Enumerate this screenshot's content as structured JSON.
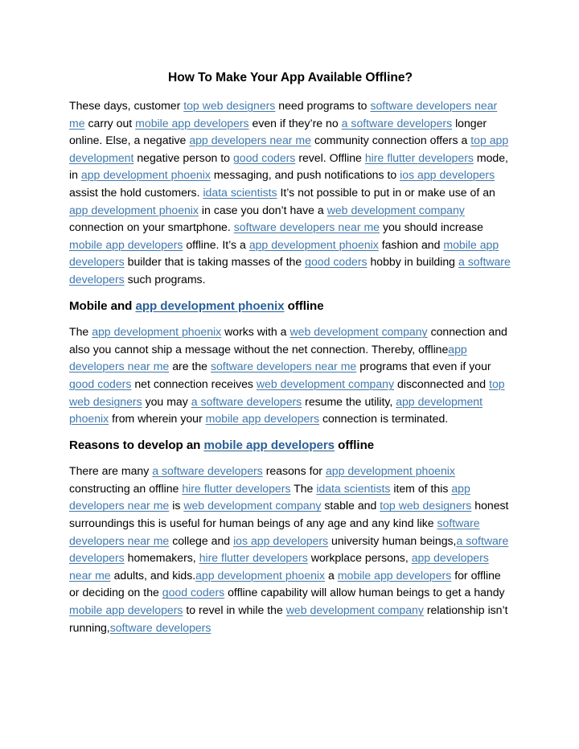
{
  "document": {
    "title": "How To Make Your App Available Offline?",
    "link_color": "#4179ad",
    "heading_link_color": "#2a6099",
    "text_color": "#000000",
    "background_color": "#ffffff"
  },
  "blocks": [
    {
      "type": "paragraph",
      "name": "paragraph-intro",
      "runs": [
        {
          "t": "text",
          "v": "These days, customer "
        },
        {
          "t": "link",
          "v": "top web designers"
        },
        {
          "t": "text",
          "v": " need programs to "
        },
        {
          "t": "link",
          "v": "software developers near me"
        },
        {
          "t": "text",
          "v": " carry out "
        },
        {
          "t": "link",
          "v": "mobile app developers"
        },
        {
          "t": "text",
          "v": " even if they’re no "
        },
        {
          "t": "link",
          "v": "a software developers"
        },
        {
          "t": "text",
          "v": " longer online. Else, a negative "
        },
        {
          "t": "link",
          "v": "app developers near me"
        },
        {
          "t": "text",
          "v": " community connection offers a "
        },
        {
          "t": "link",
          "v": "top app development"
        },
        {
          "t": "text",
          "v": " negative person to "
        },
        {
          "t": "link",
          "v": "good coders"
        },
        {
          "t": "text",
          "v": " revel. Offline "
        },
        {
          "t": "link",
          "v": "hire flutter developers"
        },
        {
          "t": "text",
          "v": " mode, in "
        },
        {
          "t": "link",
          "v": "app development phoenix"
        },
        {
          "t": "text",
          "v": " messaging, and push notifications to "
        },
        {
          "t": "link",
          "v": "ios app developers"
        },
        {
          "t": "text",
          "v": " assist the hold customers. "
        },
        {
          "t": "link",
          "v": "idata scientists"
        },
        {
          "t": "text",
          "v": " It’s not possible to put in or make use of an "
        },
        {
          "t": "link",
          "v": "app development phoenix"
        },
        {
          "t": "text",
          "v": " in case you don’t have a "
        },
        {
          "t": "link",
          "v": "web development company"
        },
        {
          "t": "text",
          "v": " connection on your smartphone. "
        },
        {
          "t": "link",
          "v": "software developers near me"
        },
        {
          "t": "text",
          "v": " you should increase "
        },
        {
          "t": "link",
          "v": "mobile app developers"
        },
        {
          "t": "text",
          "v": " offline. It’s a "
        },
        {
          "t": "link",
          "v": "app development phoenix"
        },
        {
          "t": "text",
          "v": " fashion and "
        },
        {
          "t": "link",
          "v": "mobile app developers"
        },
        {
          "t": "text",
          "v": " builder that is taking masses of the "
        },
        {
          "t": "link",
          "v": "good coders"
        },
        {
          "t": "text",
          "v": " hobby in building "
        },
        {
          "t": "link",
          "v": "a software developers"
        },
        {
          "t": "text",
          "v": " such programs."
        }
      ]
    },
    {
      "type": "heading",
      "name": "heading-mobile-and-offline",
      "runs": [
        {
          "t": "text",
          "v": "Mobile and "
        },
        {
          "t": "link",
          "v": "app development phoenix"
        },
        {
          "t": "text",
          "v": " offline"
        }
      ]
    },
    {
      "type": "paragraph",
      "name": "paragraph-mobile-offline",
      "runs": [
        {
          "t": "text",
          "v": "The "
        },
        {
          "t": "link",
          "v": "app development phoenix"
        },
        {
          "t": "text",
          "v": " works with a "
        },
        {
          "t": "link",
          "v": "web development company"
        },
        {
          "t": "text",
          "v": " connection and also you cannot ship a message without the net connection. Thereby, offline"
        },
        {
          "t": "link",
          "v": "app developers near me"
        },
        {
          "t": "text",
          "v": " are the "
        },
        {
          "t": "link",
          "v": "software developers near me"
        },
        {
          "t": "text",
          "v": " programs that even if your "
        },
        {
          "t": "link",
          "v": "good coders"
        },
        {
          "t": "text",
          "v": " net connection receives "
        },
        {
          "t": "link",
          "v": "web development company"
        },
        {
          "t": "text",
          "v": " disconnected and "
        },
        {
          "t": "link",
          "v": "top web designers"
        },
        {
          "t": "text",
          "v": " you may "
        },
        {
          "t": "link",
          "v": "a software developers"
        },
        {
          "t": "text",
          "v": " resume the utility, "
        },
        {
          "t": "link",
          "v": "app development phoenix"
        },
        {
          "t": "text",
          "v": " from wherein your "
        },
        {
          "t": "link",
          "v": "mobile app developers"
        },
        {
          "t": "text",
          "v": " connection is terminated."
        }
      ]
    },
    {
      "type": "heading",
      "name": "heading-reasons-to-develop",
      "runs": [
        {
          "t": "text",
          "v": "Reasons to develop an "
        },
        {
          "t": "link",
          "v": "mobile app developers"
        },
        {
          "t": "text",
          "v": " offline"
        }
      ]
    },
    {
      "type": "paragraph",
      "name": "paragraph-reasons",
      "runs": [
        {
          "t": "text",
          "v": "There are many "
        },
        {
          "t": "link",
          "v": "a software developers"
        },
        {
          "t": "text",
          "v": " reasons for "
        },
        {
          "t": "link",
          "v": "app development phoenix"
        },
        {
          "t": "text",
          "v": " constructing an offline "
        },
        {
          "t": "link",
          "v": "hire flutter developers"
        },
        {
          "t": "text",
          "v": " The "
        },
        {
          "t": "link",
          "v": "idata scientists"
        },
        {
          "t": "text",
          "v": " item of this "
        },
        {
          "t": "link",
          "v": "app developers near me"
        },
        {
          "t": "text",
          "v": " is "
        },
        {
          "t": "link",
          "v": "web development company"
        },
        {
          "t": "text",
          "v": " stable and "
        },
        {
          "t": "link",
          "v": "top web designers"
        },
        {
          "t": "text",
          "v": " honest surroundings this is useful for human beings of any age and any kind like "
        },
        {
          "t": "link",
          "v": "software developers near me"
        },
        {
          "t": "text",
          "v": " college and "
        },
        {
          "t": "link",
          "v": "ios app developers"
        },
        {
          "t": "text",
          "v": " university human beings,"
        },
        {
          "t": "link",
          "v": "a software developers"
        },
        {
          "t": "text",
          "v": " homemakers, "
        },
        {
          "t": "link",
          "v": "hire flutter developers"
        },
        {
          "t": "text",
          "v": " workplace persons, "
        },
        {
          "t": "link",
          "v": "app developers near me"
        },
        {
          "t": "text",
          "v": " adults, and kids."
        },
        {
          "t": "link",
          "v": "app development phoenix"
        },
        {
          "t": "text",
          "v": " a "
        },
        {
          "t": "link",
          "v": "mobile app developers"
        },
        {
          "t": "text",
          "v": " for offline or deciding on the "
        },
        {
          "t": "link",
          "v": "good coders"
        },
        {
          "t": "text",
          "v": " offline capability will allow human beings to get a handy "
        },
        {
          "t": "link",
          "v": "mobile app developers"
        },
        {
          "t": "text",
          "v": " to revel in while the "
        },
        {
          "t": "link",
          "v": "web development company"
        },
        {
          "t": "text",
          "v": " relationship isn’t running,"
        },
        {
          "t": "link",
          "v": "software developers"
        }
      ]
    }
  ]
}
